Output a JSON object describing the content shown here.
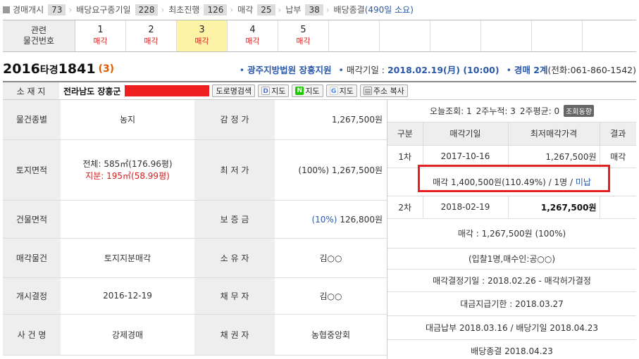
{
  "progress": [
    {
      "label": "경매개시",
      "count": "73"
    },
    {
      "label": "배당요구종기일",
      "count": "228"
    },
    {
      "label": "최초진행",
      "count": "126"
    },
    {
      "label": "매각",
      "count": "25"
    },
    {
      "label": "납부",
      "count": "38"
    },
    {
      "label": "배당종결",
      "extra": "(490일 소요)"
    }
  ],
  "rounds": {
    "head_line1": "관련",
    "head_line2": "물건번호",
    "items": [
      {
        "num": "1",
        "status": "매각"
      },
      {
        "num": "2",
        "status": "매각"
      },
      {
        "num": "3",
        "status": "매각"
      },
      {
        "num": "4",
        "status": "매각"
      },
      {
        "num": "5",
        "status": "매각"
      }
    ]
  },
  "case": {
    "year": "2016",
    "type": "타경",
    "number": "1841",
    "count": "(3)",
    "court": "광주지방법원 장흥지원",
    "sale_date_label": "매각기일 : ",
    "sale_date": "2018.02.19(月) (10:00)",
    "dept": "경매 2계",
    "phone": "(전화:061-860-1542)"
  },
  "address": {
    "label": "소 재 지",
    "value": "전라남도 장흥군",
    "buttons": {
      "road": "도로명검색",
      "daum": "지도",
      "naver": "지도",
      "google": "지도",
      "copy": "주소 복사"
    }
  },
  "info": {
    "use_label": "물건종별",
    "use_value": "농지",
    "appraisal_label": "감 정 가",
    "appraisal_value": "1,267,500원",
    "land_label": "토지면적",
    "land_total": "전체: 585㎡(176.96평)",
    "land_share": "지분: 195㎡(58.99평)",
    "min_label": "최 저 가",
    "min_value": "(100%) 1,267,500원",
    "building_label": "건물면적",
    "building_value": "",
    "deposit_label": "보 증 금",
    "deposit_pct": "(10%)",
    "deposit_value": "126,800원",
    "sale_item_label": "매각물건",
    "sale_item_value": "토지지분매각",
    "owner_label": "소 유 자",
    "owner_value": "김○○",
    "open_label": "개시결정",
    "open_value": "2016-12-19",
    "debtor_label": "채 무 자",
    "debtor_value": "김○○",
    "case_name_label": "사 건 명",
    "case_name_value": "강제경매",
    "creditor_label": "채 권 자",
    "creditor_value": "농협중앙회"
  },
  "panel": {
    "today_label": "오늘조회: 1",
    "week2_label": "2주누적: 3",
    "avg_label": "2주평균: 0",
    "trend_btn": "조회동향",
    "columns": [
      "구분",
      "매각기일",
      "최저매각가격",
      "결과"
    ],
    "rows": [
      {
        "round": "1차",
        "date": "2017-10-16",
        "price": "1,267,500원",
        "result": "매각"
      },
      {
        "round": "2차",
        "date": "2018-02-19",
        "price": "1,267,500원",
        "result": ""
      }
    ],
    "first_sale_detail": "매각 1,400,500원(110.49%) / 1명 / ",
    "first_sale_unpaid": "미납",
    "sale_result": "매각 : 1,267,500원 (100%)",
    "bidders": "(입찰1명,매수인:공○○)",
    "decision": "매각결정기일 : 2018.02.26 - 매각허가결정",
    "deadline": "대금지급기한 : 2018.03.27",
    "payment": "대금납부 2018.03.16 / 배당기일 2018.04.23",
    "closing": "배당종결 2018.04.23"
  }
}
